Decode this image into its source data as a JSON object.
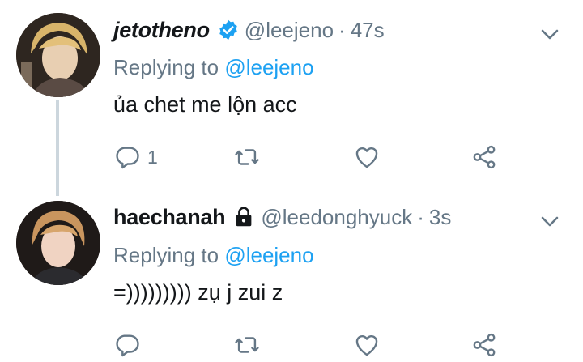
{
  "tweets": [
    {
      "display_name": "jetotheno",
      "handle": "@leejeno",
      "separator": "·",
      "time": "47s",
      "verified": true,
      "replying_prefix": "Replying to",
      "replying_to": "@leejeno",
      "text": "ủa chet me lộn acc",
      "reply_count": "1"
    },
    {
      "display_name": "haechanah",
      "handle": "@leedonghyuck",
      "separator": "·",
      "time": "3s",
      "protected": true,
      "replying_prefix": "Replying to",
      "replying_to": "@leejeno",
      "text": "=))))))))) zụ j zui z",
      "reply_count": ""
    }
  ],
  "icons": {
    "reply": "reply-icon",
    "retweet": "retweet-icon",
    "like": "heart-icon",
    "share": "share-icon",
    "menu": "chevron-down-icon",
    "verified": "verified-badge-icon",
    "protected": "lock-icon"
  },
  "colors": {
    "accent": "#1da1f2",
    "secondary_text": "#657786",
    "primary_text": "#14171a",
    "thread_line": "#ccd6dd"
  }
}
